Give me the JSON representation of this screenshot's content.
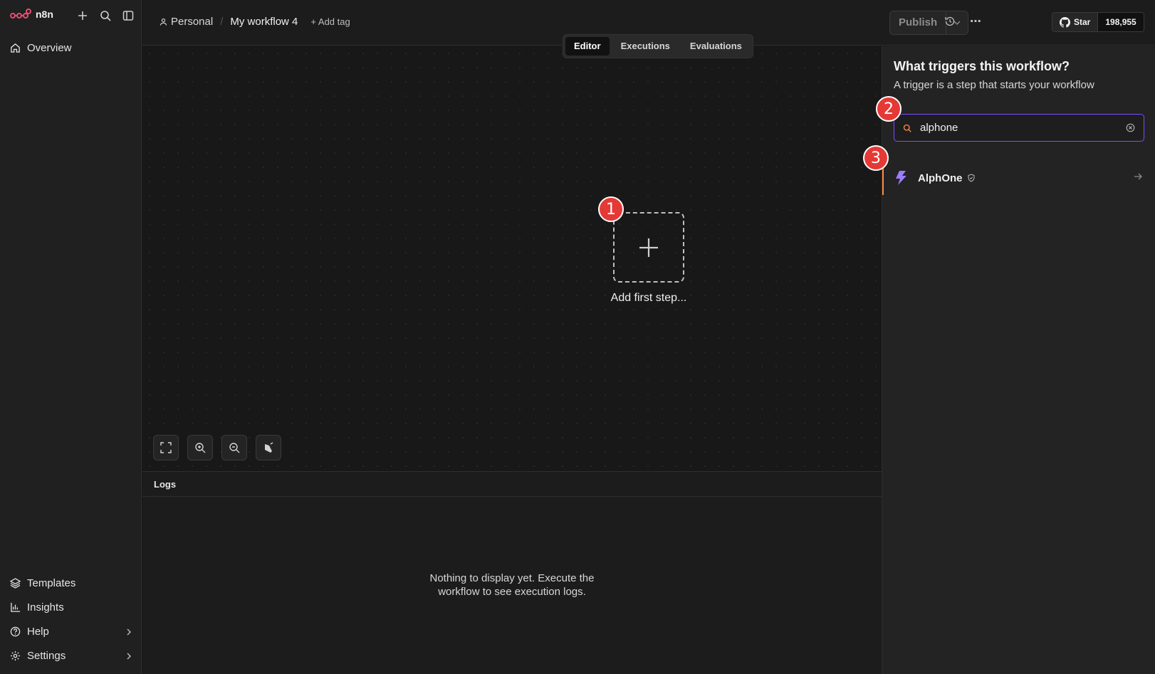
{
  "app": {
    "logo_text": "n8n"
  },
  "sidebar": {
    "items": [
      {
        "label": "Overview",
        "icon": "home-icon"
      },
      {
        "label": "Templates",
        "icon": "templates-icon"
      },
      {
        "label": "Insights",
        "icon": "chart-icon"
      },
      {
        "label": "Help",
        "icon": "help-icon"
      },
      {
        "label": "Settings",
        "icon": "gear-icon"
      }
    ]
  },
  "header": {
    "project": "Personal",
    "workflow_title": "My workflow 4",
    "add_tag": "+ Add tag",
    "publish_label": "Publish",
    "github_star": "Star",
    "github_count": "198,955"
  },
  "tabs": [
    {
      "label": "Editor",
      "active": true
    },
    {
      "label": "Executions",
      "active": false
    },
    {
      "label": "Evaluations",
      "active": false
    }
  ],
  "canvas": {
    "add_step_label": "Add first step..."
  },
  "annotations": [
    "1",
    "2",
    "3"
  ],
  "logs": {
    "title": "Logs",
    "empty_line1": "Nothing to display yet. Execute the",
    "empty_line2": "workflow to see execution logs."
  },
  "panel": {
    "title": "What triggers this workflow?",
    "subtitle": "A trigger is a step that starts your workflow",
    "search_value": "alphone",
    "results": [
      {
        "name": "AlphOne",
        "icon": "bolt-icon"
      }
    ]
  },
  "colors": {
    "accent": "#7c4dff",
    "orange": "#ff8a3d",
    "badge_red": "#e53935",
    "brand": "#ea4b71"
  }
}
